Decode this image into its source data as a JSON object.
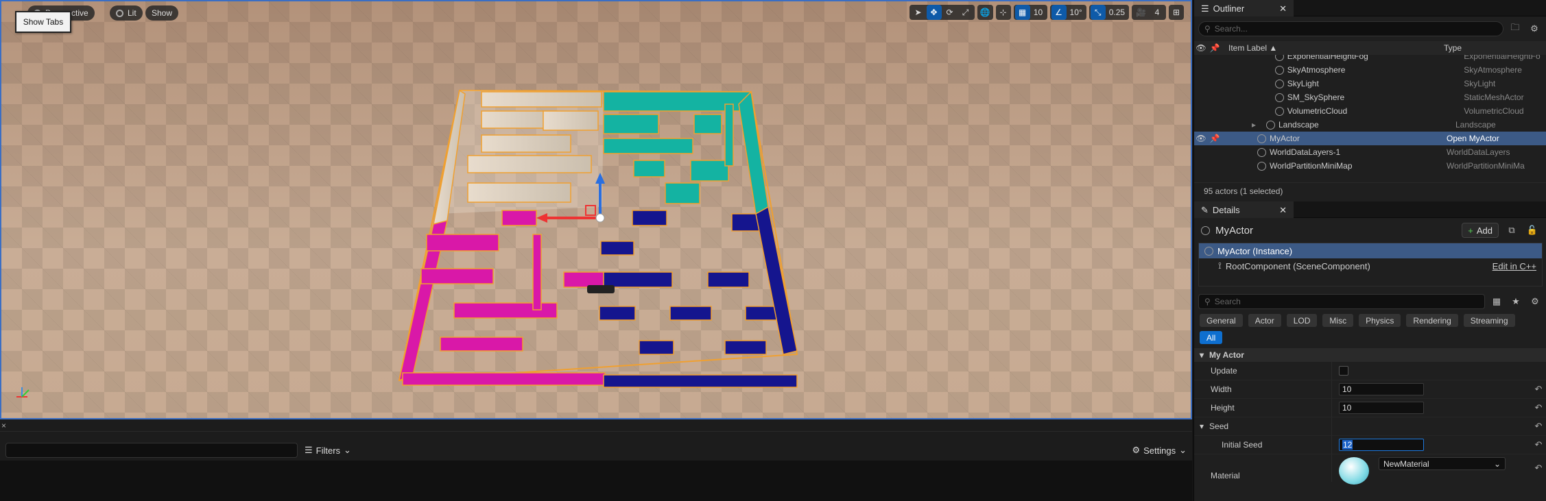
{
  "viewport": {
    "perspective_label": "Perspective",
    "lit_label": "Lit",
    "show_label": "Show",
    "show_tabs_tooltip": "Show Tabs",
    "toolbar": {
      "grid_snap_value": "10",
      "rotation_snap_value": "10°",
      "scale_snap_value": "0.25",
      "camera_speed_value": "4"
    }
  },
  "bottom_panel": {
    "filters_label": "Filters",
    "settings_label": "Settings",
    "close_glyph": "×"
  },
  "outliner": {
    "tab_label": "Outliner",
    "search_placeholder": "Search...",
    "col_item_label": "Item Label",
    "col_type": "Type",
    "rows": [
      {
        "label": "ExponentialHeightFog",
        "type": "ExponentialHeightFo"
      },
      {
        "label": "SkyAtmosphere",
        "type": "SkyAtmosphere"
      },
      {
        "label": "SkyLight",
        "type": "SkyLight"
      },
      {
        "label": "SM_SkySphere",
        "type": "StaticMeshActor"
      },
      {
        "label": "VolumetricCloud",
        "type": "VolumetricCloud"
      },
      {
        "label": "Landscape",
        "type": "Landscape"
      },
      {
        "label": "MyActor",
        "type": "Open MyActor"
      },
      {
        "label": "WorldDataLayers-1",
        "type": "WorldDataLayers"
      },
      {
        "label": "WorldPartitionMiniMap",
        "type": "WorldPartitionMiniMa"
      }
    ],
    "status": "95 actors (1 selected)"
  },
  "details": {
    "tab_label": "Details",
    "actor_name": "MyActor",
    "add_label": "Add",
    "instance_label": "MyActor (Instance)",
    "root_component_label": "RootComponent (SceneComponent)",
    "edit_cpp_label": "Edit in C++",
    "search_placeholder": "Search",
    "categories": [
      "General",
      "Actor",
      "LOD",
      "Misc",
      "Physics",
      "Rendering",
      "Streaming",
      "All"
    ],
    "section_my_actor": "My Actor",
    "props": {
      "update_label": "Update",
      "width_label": "Width",
      "width_value": "10",
      "height_label": "Height",
      "height_value": "10",
      "seed_section": "Seed",
      "initial_seed_label": "Initial Seed",
      "initial_seed_value": "12",
      "material_label": "Material",
      "material_value": "NewMaterial"
    }
  }
}
